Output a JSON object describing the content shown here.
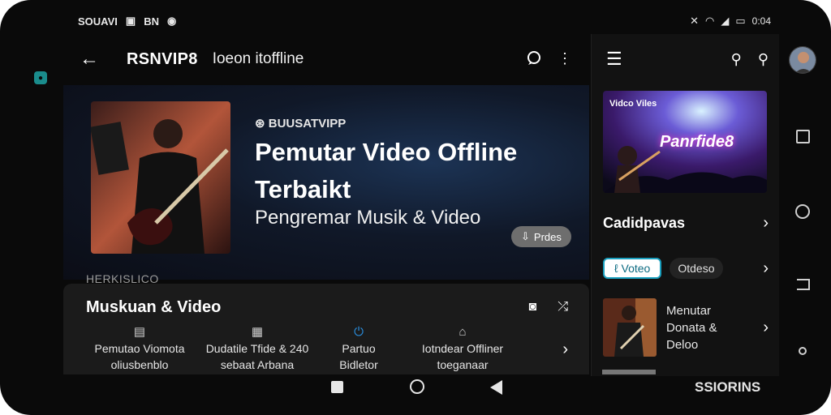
{
  "status_bar": {
    "left_text": "SOUAVI",
    "left_icons": [
      "sim-icon",
      "bn-indicator-icon",
      "message-icon"
    ],
    "bn_label": "BN",
    "clock": "0:04",
    "right_icons": [
      "mute-icon",
      "wifi-icon",
      "signal-icon",
      "battery-icon"
    ]
  },
  "app_bar": {
    "title": "RSNVIP8",
    "subtitle": "Ioeon itoffline",
    "back_icon": "back-arrow-icon",
    "actions": [
      "chat-icon",
      "more-vert-icon"
    ]
  },
  "hero": {
    "label": "BUUSATVIPP",
    "label_icon": "logo-mark-icon",
    "title_line1": "Pemutar Video Offline",
    "title_line2": "Terbaikt",
    "subtitle": "Pengremar Musik & Video",
    "chip_label": "Prdes",
    "chip_icon": "download-icon"
  },
  "section_overline": "HERKISLICO",
  "sheet": {
    "title": "Muskuan & Video",
    "actions": [
      "cast-icon",
      "shuffle-icon"
    ],
    "items": [
      {
        "icon": "document-icon",
        "line1": "Pemutao Viomota",
        "line2": "oliusbenblo"
      },
      {
        "icon": "folder-icon",
        "line1": "Dudatile Tfide & 240",
        "line2": "sebaat Arbana"
      },
      {
        "icon": "power-icon",
        "line1": "Partuo",
        "line2": "Bidletor"
      },
      {
        "icon": "home-icon",
        "line1": "Iotndear Offliner",
        "line2": "toeganaar"
      }
    ]
  },
  "drawer": {
    "promo_title": "Panrfide8",
    "promo_logo": "Vidco Viles",
    "category_label": "Cadidpavas",
    "pill_primary": "Voteo",
    "pill_secondary": "Otdeso",
    "track": {
      "line1": "Menutar",
      "line2": "Donata &",
      "line3": "Deloo"
    }
  },
  "nav_caption": "SSIORINS",
  "colors": {
    "background": "#0a0a0a",
    "sheet": "#1b1b1b",
    "drawer": "#121212",
    "accent": "#1aa0bf",
    "chip": "#6e6e6e"
  }
}
